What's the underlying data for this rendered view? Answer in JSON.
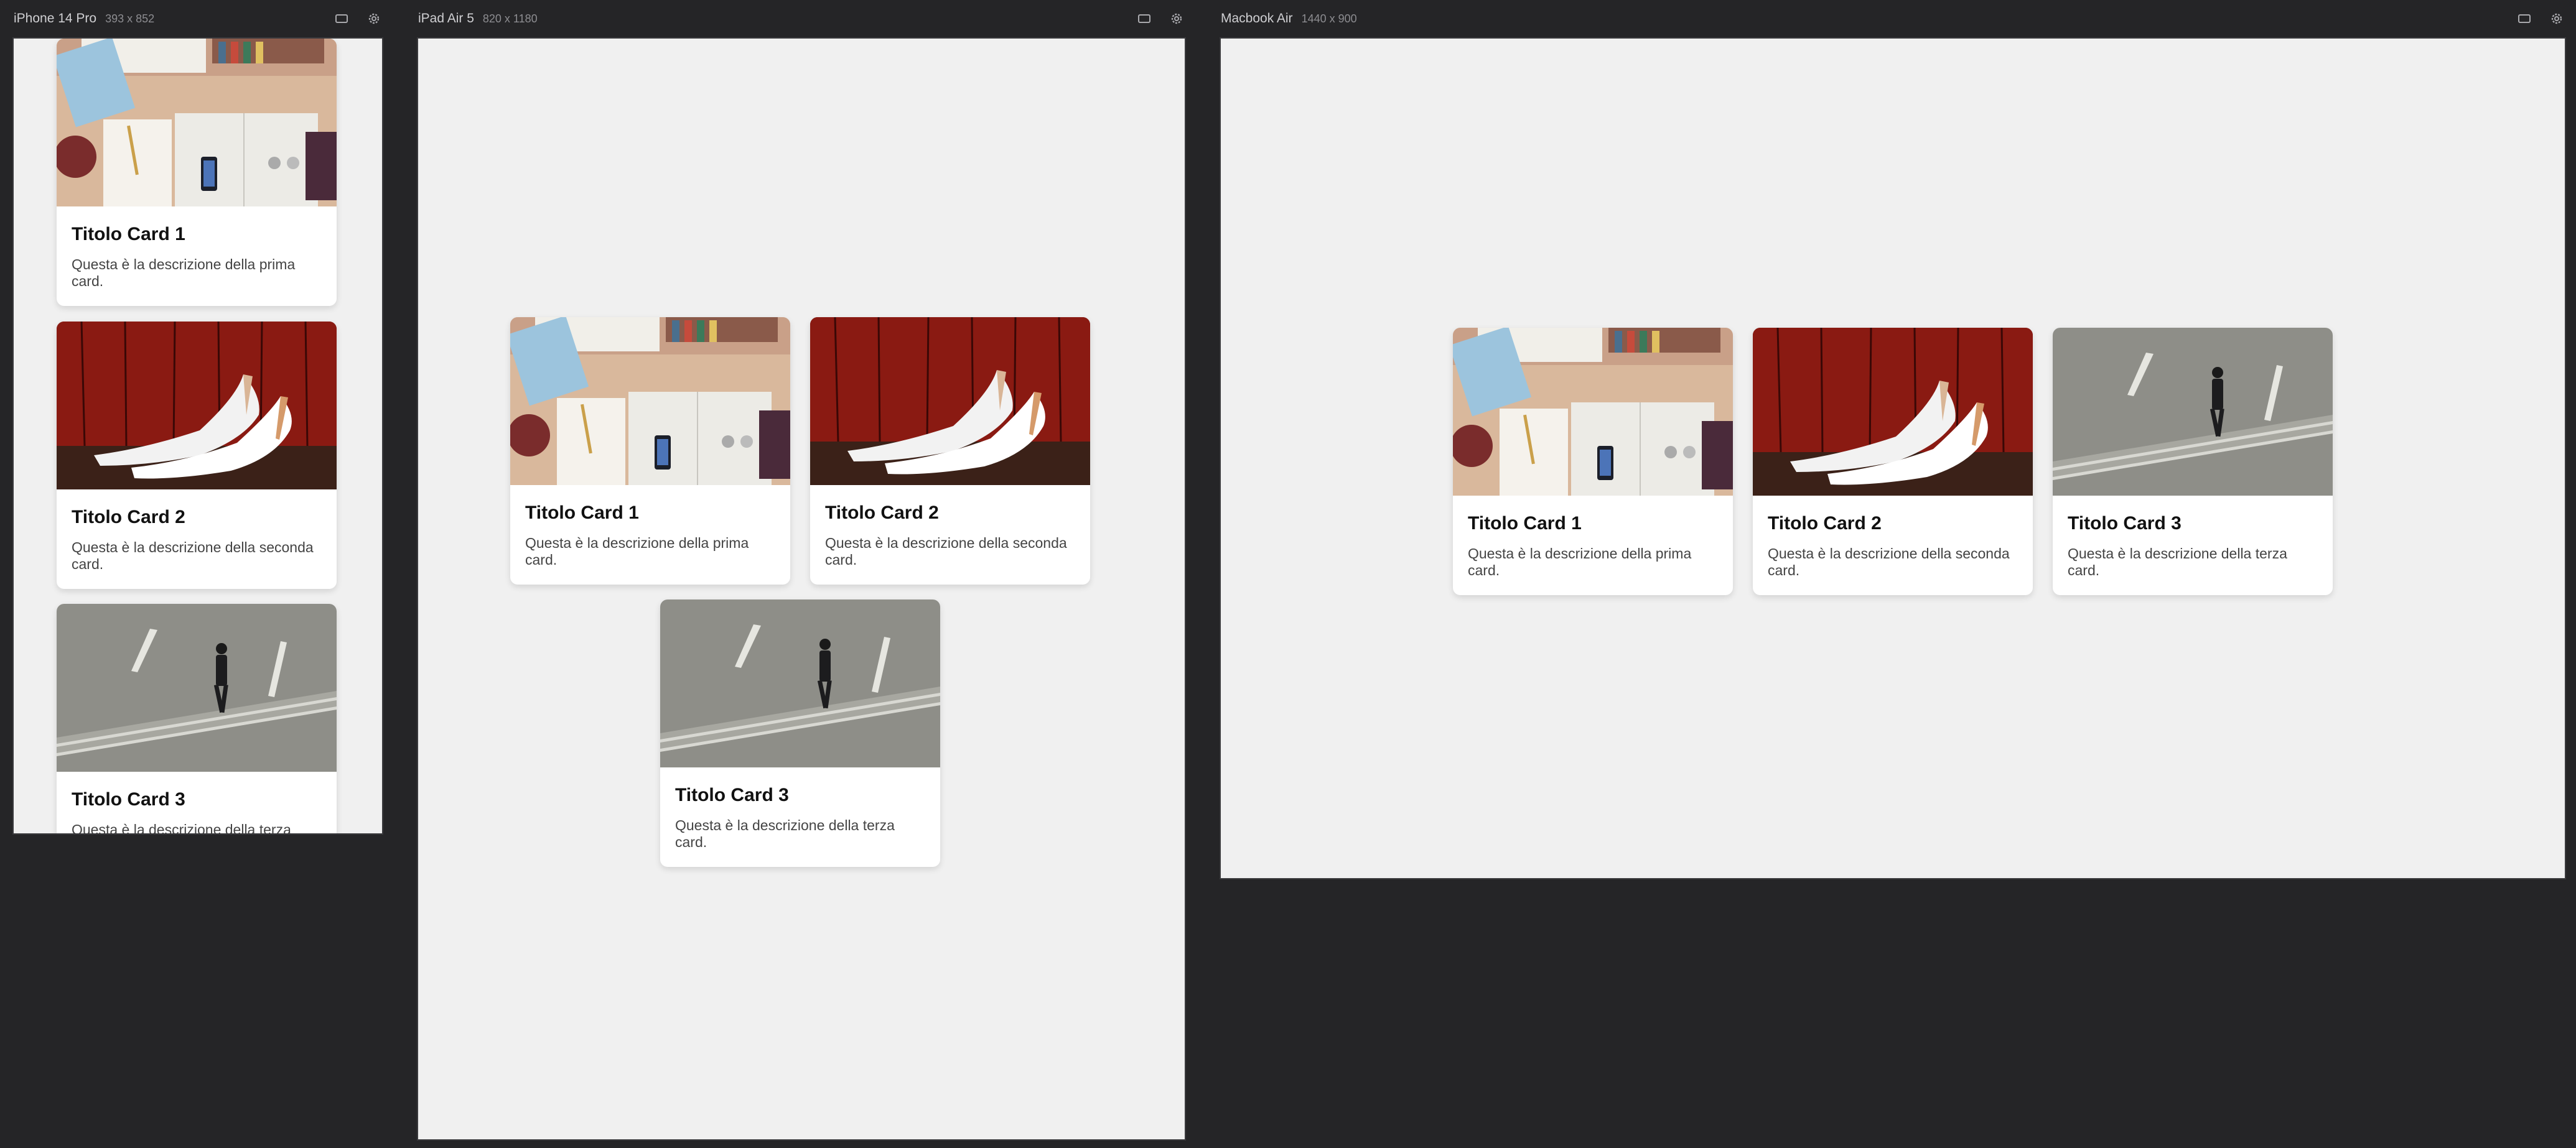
{
  "devices": [
    {
      "name": "iPhone 14 Pro",
      "size": "393 x 852"
    },
    {
      "name": "iPad Air 5",
      "size": "820 x 1180"
    },
    {
      "name": "Macbook Air",
      "size": "1440 x 900"
    }
  ],
  "cards": [
    {
      "title": "Titolo Card 1",
      "description": "Questa è la descrizione della prima card.",
      "image": "desk-flatlay-image"
    },
    {
      "title": "Titolo Card 2",
      "description": "Questa è la descrizione della seconda card.",
      "image": "white-heels-image"
    },
    {
      "title": "Titolo Card 3",
      "description": "Questa è la descrizione della terza card.",
      "image": "man-walking-road-image"
    }
  ],
  "icons": {
    "viewport": "device-frame-icon",
    "settings": "gear-icon"
  },
  "colors": {
    "canvas": "#252527",
    "viewport_bg": "#f0f0f0",
    "card_bg": "#ffffff"
  }
}
